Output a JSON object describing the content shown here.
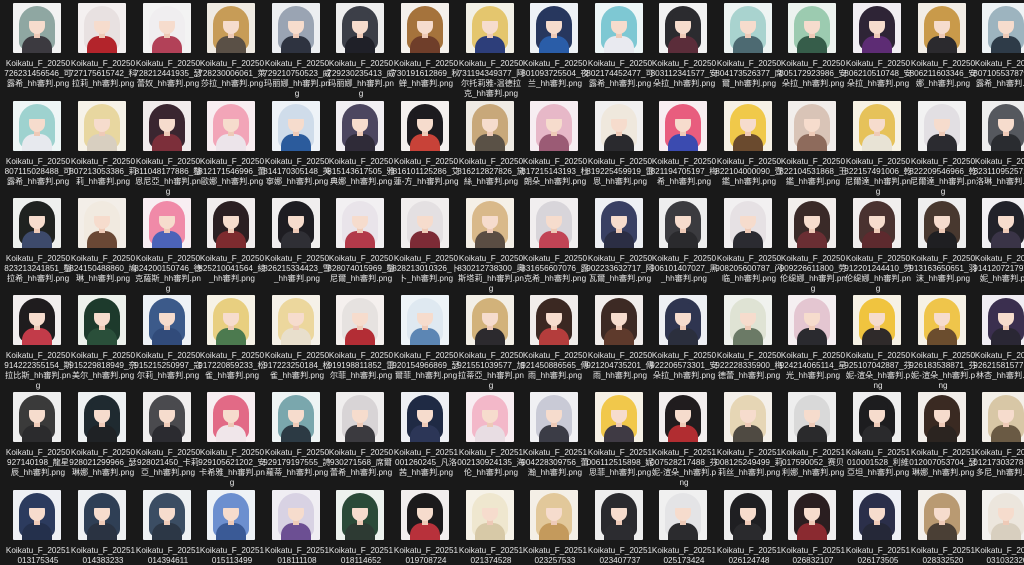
{
  "window": {
    "background": "#191919",
    "text_color": "#e6e6e6"
  },
  "files": [
    {
      "label": "Koikatu_F_20250726231456546_可露希_hh審判.png",
      "thumb_bg": "#f2f2f2",
      "hair": "#8fa7a2",
      "outfit": "#3c3a40"
    },
    {
      "label": "Koikatu_F_20250727175615742_科拉莉_hh審判.png",
      "thumb_bg": "#f4f0f0",
      "hair": "#e8e1e1",
      "outfit": "#b3242b"
    },
    {
      "label": "Koikatu_F_20250728212441935_瑟蕾奴_hh審判.png",
      "thumb_bg": "#f3f3f3",
      "hair": "#f0eef0",
      "outfit": "#b24158"
    },
    {
      "label": "Koikatu_F_20250728230006061_萊莎拉_hh審判.png",
      "thumb_bg": "#efeae2",
      "hair": "#c79c57",
      "outfit": "#5a5046"
    },
    {
      "label": "Koikatu_F_20250729210750523_威玛丽娜_hh審判.png",
      "thumb_bg": "#eceef1",
      "hair": "#9aa4b3",
      "outfit": "#2e3340"
    },
    {
      "label": "Koikatu_F_20250729230235413_威玛丽娜_hh審判.png",
      "thumb_bg": "#eeeeee",
      "hair": "#3c3f48",
      "outfit": "#1f2028"
    },
    {
      "label": "Koikatu_F_20250730191612869_秋蝉_hh審判.png",
      "thumb_bg": "#f5f1ec",
      "hair": "#a5733c",
      "outfit": "#6f3e2a"
    },
    {
      "label": "Koikatu_F_20250731194349377_阿尔托莉雅-温德拉克_hh審判.png",
      "thumb_bg": "#f2f0e6",
      "hair": "#e4c66e",
      "outfit": "#2d3e7a"
    },
    {
      "label": "Koikatu_F_20250801093725504_夜兰_hh審判.png",
      "thumb_bg": "#eef2f6",
      "hair": "#27375e",
      "outfit": "#2a5da8"
    },
    {
      "label": "Koikatu_F_20250802174452477_可露希_hh審判.png",
      "thumb_bg": "#eef6f7",
      "hair": "#7ec8d3",
      "outfit": "#e9eaf0"
    },
    {
      "label": "Koikatu_F_20250803112341577_安朵拉_hh審判.png",
      "thumb_bg": "#f2f2f2",
      "hair": "#2b2b2f",
      "outfit": "#5b2d3a"
    },
    {
      "label": "Koikatu_F_20250804173526377_席爾_hh審判.png",
      "thumb_bg": "#eef4f3",
      "hair": "#a9d3cf",
      "outfit": "#4d6a72"
    },
    {
      "label": "Koikatu_F_20250805172923986_安朵拉_hh審判.png",
      "thumb_bg": "#edf3ef",
      "hair": "#9ccbb0",
      "outfit": "#365d4a"
    },
    {
      "label": "Koikatu_F_20250806210510748_安朵拉_hh審判.png",
      "thumb_bg": "#f1eef3",
      "hair": "#2e2436",
      "outfit": "#5d2c74"
    },
    {
      "label": "Koikatu_F_20250806211603346_安娜_hh審判.png",
      "thumb_bg": "#f2ede6",
      "hair": "#c99a4a",
      "outfit": "#2b2a2e"
    },
    {
      "label": "Koikatu_F_20250807105537879_可露希_hh審判.png",
      "thumb_bg": "#eef3f5",
      "hair": "#9db4bf",
      "outfit": "#2e3b48"
    },
    {
      "label": "Koikatu_F_20250807115028488_可露希_hh審判.png",
      "thumb_bg": "#eef6f6",
      "hair": "#9ed2cf",
      "outfit": "#e7e9ee"
    },
    {
      "label": "Koikatu_F_20250807213053386_莉莉_hh審判.png",
      "thumb_bg": "#f6f2e8",
      "hair": "#e8d7a0",
      "outfit": "#d8cfc0"
    },
    {
      "label": "Koikatu_F_20250811048177886_鑿恩尼亞_hh審判.png",
      "thumb_bg": "#f1ecec",
      "hair": "#3a2630",
      "outfit": "#7c2f3a"
    },
    {
      "label": "Koikatu_F_20250812171546996_蕾歐娜_hh審判.png",
      "thumb_bg": "#f8eef1",
      "hair": "#f2a5b8",
      "outfit": "#ece4ea"
    },
    {
      "label": "Koikatu_F_20250814170305148_芙寧娜_hh審判.png",
      "thumb_bg": "#eef3f8",
      "hair": "#cfdcea",
      "outfit": "#2b5b9c"
    },
    {
      "label": "Koikatu_F_20250815143617505_雅典娜_hh審判.png",
      "thumb_bg": "#f1eff3",
      "hair": "#4c4660",
      "outfit": "#2f2b38"
    },
    {
      "label": "Koikatu_F_20250816101125286_艾蓮-方_hh審判.png",
      "thumb_bg": "#f4f0ee",
      "hair": "#1d1b1f",
      "outfit": "#c84238"
    },
    {
      "label": "Koikatu_F_20250816212827826_黛絲_hh審判.png",
      "thumb_bg": "#efebe4",
      "hair": "#c8a87a",
      "outfit": "#5a5146"
    },
    {
      "label": "Koikatu_F_20250817215143193_杜朗朵_hh審判.png",
      "thumb_bg": "#f7eef2",
      "hair": "#e7b8c8",
      "outfit": "#9b5b75"
    },
    {
      "label": "Koikatu_F_20250819225459919_雷恩_hh審判.png",
      "thumb_bg": "#f1f0f0",
      "hair": "#efe8dd",
      "outfit": "#2a2a2e"
    },
    {
      "label": "Koikatu_F_20250821194705197_梅希_hh審判.png",
      "thumb_bg": "#f8eef1",
      "hair": "#e85d7e",
      "outfit": "#3b4bb0"
    },
    {
      "label": "Koikatu_F_20250822104000090_壹鑑_hh審判.png",
      "thumb_bg": "#f6f1e6",
      "hair": "#f0c94a",
      "outfit": "#6a4a2e"
    },
    {
      "label": "Koikatu_F_20250822104531868_王鑑_hh審判.png",
      "thumb_bg": "#f2eeeb",
      "hair": "#d9c4b7",
      "outfit": "#8e6b5c"
    },
    {
      "label": "Koikatu_F_20250822157491006_乾尼爾達_hh審判.png",
      "thumb_bg": "#f7f2e4",
      "hair": "#e6c25a",
      "outfit": "#e8e3d5"
    },
    {
      "label": "Koikatu_F_20250822209546966_乾尼爾達_hh審判.png",
      "thumb_bg": "#f2f2f2",
      "hair": "#e2dfe3",
      "outfit": "#2b2b30"
    },
    {
      "label": "Koikatu_F_20250823110952571_卡洛琳_hh審判.png",
      "thumb_bg": "#eeeeee",
      "hair": "#55585e",
      "outfit": "#2a2c30"
    },
    {
      "label": "Koikatu_F_20250823213241851_鑿拉希_hh審判.png",
      "thumb_bg": "#eef0ee",
      "hair": "#1f2220",
      "outfit": "#3d4a6b"
    },
    {
      "label": "Koikatu_F_20250824150488860_鳩琳_hh審判.png",
      "thumb_bg": "#f3eee8",
      "hair": "#f1eae0",
      "outfit": "#6a4835"
    },
    {
      "label": "Koikatu_F_20250824200150746_德克薩斯_hh審判.png",
      "thumb_bg": "#f8eef2",
      "hair": "#f08aa8",
      "outfit": "#4c63b8"
    },
    {
      "label": "Koikatu_F_20250825210041564_綾_hh審判.png",
      "thumb_bg": "#f1eded",
      "hair": "#2b1f22",
      "outfit": "#7d2b2f"
    },
    {
      "label": "Koikatu_F_20250826215334423_雪_hh審判.png",
      "thumb_bg": "#f0eeee",
      "hair": "#1e1d22",
      "outfit": "#2f2f35"
    },
    {
      "label": "Koikatu_F_20250828074015969_鑿尼爾_hh審判.png",
      "thumb_bg": "#f2f0f2",
      "hair": "#e9e4ea",
      "outfit": "#b23a4a"
    },
    {
      "label": "Koikatu_F_20250828213010326_卜卜_hh審判.png",
      "thumb_bg": "#f1eeee",
      "hair": "#e4e0e2",
      "outfit": "#7c2b36"
    },
    {
      "label": "Koikatu_F_20250830212738300_奧斯塔莉_hh審判.png",
      "thumb_bg": "#f5f0e7",
      "hair": "#d9b98a",
      "outfit": "#5a4d43"
    },
    {
      "label": "Koikatu_F_20250831656607076_露克希_hh審判.png",
      "thumb_bg": "#f1eeef",
      "hair": "#d8d5da",
      "outfit": "#c14455"
    },
    {
      "label": "Koikatu_F_20250902233632717_阿瓦爾_hh審判.png",
      "thumb_bg": "#eef0f4",
      "hair": "#394063",
      "outfit": "#2b2e44"
    },
    {
      "label": "Koikatu_F_20250906101407027_黑_hh審判.png",
      "thumb_bg": "#eeeeee",
      "hair": "#3b3b3f",
      "outfit": "#2a2a2d"
    },
    {
      "label": "Koikatu_F_20250908205600787_闪临_hh審判.png",
      "thumb_bg": "#f2f0f1",
      "hair": "#e6e1e4",
      "outfit": "#2b2b31"
    },
    {
      "label": "Koikatu_F_20250909226611800_劳伦缇娜_hh審判.png",
      "thumb_bg": "#f2eeec",
      "hair": "#3a2a28",
      "outfit": "#6a2e33"
    },
    {
      "label": "Koikatu_F_20250912201244410_劳伦缇娜_hh審判.png",
      "thumb_bg": "#f1eeee",
      "hair": "#4a3230",
      "outfit": "#5d2a2e"
    },
    {
      "label": "Koikatu_F_20250913163650651_羽沫_hh審判.png",
      "thumb_bg": "#eeeeee",
      "hair": "#48382f",
      "outfit": "#1f1f22"
    },
    {
      "label": "Koikatu_F_20250914120721797_佩妮_hh審判.png",
      "thumb_bg": "#f2f0f3",
      "hair": "#22222a",
      "outfit": "#3a3447"
    },
    {
      "label": "Koikatu_F_20250914222355154_斯拉比斯_hh審判.png",
      "thumb_bg": "#f1eeee",
      "hair": "#1f1c1e",
      "outfit": "#c23b49"
    },
    {
      "label": "Koikatu_F_20250915229818949_奈美尔_hh審判.png",
      "thumb_bg": "#edf1ec",
      "hair": "#1d3a2c",
      "outfit": "#2a4f3a"
    },
    {
      "label": "Koikatu_F_20250915215250997_寇尔莉_hh審判.png",
      "thumb_bg": "#eef2f6",
      "hair": "#3c5a8a",
      "outfit": "#314b7a"
    },
    {
      "label": "Koikatu_F_20250917220859233_松雀_hh審判.png",
      "thumb_bg": "#f6f2e6",
      "hair": "#e8cf80",
      "outfit": "#4c7a4f"
    },
    {
      "label": "Koikatu_F_20250917223250184_松雀_hh審判.png",
      "thumb_bg": "#f5f1e8",
      "hair": "#ecd79d",
      "outfit": "#e8dfcc"
    },
    {
      "label": "Koikatu_F_20250919198811852_雷尔菲_hh審判.png",
      "thumb_bg": "#f5f0ee",
      "hair": "#e6e2e0",
      "outfit": "#b32d35"
    },
    {
      "label": "Koikatu_F_20250920154966869_瑟爾菲_hh審判.png",
      "thumb_bg": "#eef4f8",
      "hair": "#dfe9f1",
      "outfit": "#5c86b4"
    },
    {
      "label": "Koikatu_F_20250921551039577_加拉蒂亞_hh審判.png",
      "thumb_bg": "#f3efe6",
      "hair": "#d2b27a",
      "outfit": "#2c2a2e"
    },
    {
      "label": "Koikatu_F_20250921450886565_傳雨_hh審判.png",
      "thumb_bg": "#f1edeb",
      "hair": "#3b2822",
      "outfit": "#b43d3c"
    },
    {
      "label": "Koikatu_F_20250921204735201_傳雨_hh審判.png",
      "thumb_bg": "#f1edeb",
      "hair": "#3d2a24",
      "outfit": "#5e3a2c"
    },
    {
      "label": "Koikatu_F_20250922206573301_安朵拉_hh審判.png",
      "thumb_bg": "#eef0f4",
      "hair": "#2f3550",
      "outfit": "#2b2f3d"
    },
    {
      "label": "Koikatu_F_20250922228335900_梅德蕾_hh審判.png",
      "thumb_bg": "#f0f2ee",
      "hair": "#dfe3d4",
      "outfit": "#6b7a66"
    },
    {
      "label": "Koikatu_F_20250924214065114_星光_hh審判.png",
      "thumb_bg": "#f5eff1",
      "hair": "#e4c6d1",
      "outfit": "#2a2a2f"
    },
    {
      "label": "Koikatu_F_20250925107042887_芬妮-渲朵_hh審判.png",
      "thumb_bg": "#f6f1e5",
      "hair": "#f0c43f",
      "outfit": "#2f2a2a"
    },
    {
      "label": "Koikatu_F_20250926183538871_芬妮-渲朵_hh審判.png",
      "thumb_bg": "#f6f1e6",
      "hair": "#efc54b",
      "outfit": "#6b4d2e"
    },
    {
      "label": "Koikatu_F_20250926215815771_藤林杏_hh審判.png",
      "thumb_bg": "#f0edf3",
      "hair": "#3b2f4f",
      "outfit": "#2a2734"
    },
    {
      "label": "Koikatu_F_20250927140198_龍星辰_hh審判.png",
      "thumb_bg": "#eeeeee",
      "hair": "#3a3a3a",
      "outfit": "#2b2b2d"
    },
    {
      "label": "Koikatu_F_20250928021299966_瑟琳娜_hh審判.png",
      "thumb_bg": "#eef1f2",
      "hair": "#1f2a30",
      "outfit": "#1f2225"
    },
    {
      "label": "Koikatu_F_20250928021450_卡莉亞_hh審判.png",
      "thumb_bg": "#f0eeee",
      "hair": "#4a4a4e",
      "outfit": "#2b2b30"
    },
    {
      "label": "Koikatu_F_20250929105621202_安卡希雅_hh審判.png",
      "thumb_bg": "#f7eef1",
      "hair": "#e26a86",
      "outfit": "#f0e6ea"
    },
    {
      "label": "Koikatu_F_20250929179197555_詩蘿蒂_hh審判.png",
      "thumb_bg": "#eef4f4",
      "hair": "#7aa7ad",
      "outfit": "#2c3a44"
    },
    {
      "label": "Koikatu_F_20250930271568_席爾蕾希_hh審判.png",
      "thumb_bg": "#f0eeee",
      "hair": "#d8d4d6",
      "outfit": "#3b3a3f"
    },
    {
      "label": "Koikatu_F_20251001260245_凡洛茜_hh審判.png",
      "thumb_bg": "#eef0f4",
      "hair": "#1f2a44",
      "outfit": "#2c3657"
    },
    {
      "label": "Koikatu_F_20251002130924135_海伦_hh審判.png",
      "thumb_bg": "#f8eef2",
      "hair": "#f3b8c9",
      "outfit": "#e8dde3"
    },
    {
      "label": "Koikatu_F_20251004228309756_蕾瀚_hh審判.png",
      "thumb_bg": "#f0f0f3",
      "hair": "#c9cad6",
      "outfit": "#3b3c46"
    },
    {
      "label": "Koikatu_F_20251006112515898_妮思菲_hh審判.png",
      "thumb_bg": "#f6f1e6",
      "hair": "#f1c84b",
      "outfit": "#3f3a44"
    },
    {
      "label": "Koikatu_F_20251007528217488_芬妮-渲朵_hh審判.png",
      "thumb_bg": "#f2eeee",
      "hair": "#201c1e",
      "outfit": "#b12d31"
    },
    {
      "label": "Koikatu_F_20251008125249499_莉莉丝_hh審判.png",
      "thumb_bg": "#f4f0ea",
      "hair": "#e6d6b5",
      "outfit": "#4f4a42"
    },
    {
      "label": "Koikatu_F_20251017590052_赛贝利娜_hh審判.png",
      "thumb_bg": "#eeeeee",
      "hair": "#d9d9d9",
      "outfit": "#2a2a2c"
    },
    {
      "label": "Koikatu_F_20251010001528_利維亞坦_hh審判.png",
      "thumb_bg": "#eeeeee",
      "hair": "#1d1d1f",
      "outfit": "#2a2a2c"
    },
    {
      "label": "Koikatu_F_20251012007053704_瑟琳娜_hh審判.png",
      "thumb_bg": "#f2eeea",
      "hair": "#3a2a22",
      "outfit": "#2b2420"
    },
    {
      "label": "Koikatu_F_20251012173032783_曼多尼_hh審判.png",
      "thumb_bg": "#f3efe8",
      "hair": "#d8c7a6",
      "outfit": "#6a5a44"
    },
    {
      "label": "Koikatu_F_20251013175345",
      "thumb_bg": "#eef0f4",
      "hair": "#2c3b5e",
      "outfit": "#24304c"
    },
    {
      "label": "Koikatu_F_20251014383233",
      "thumb_bg": "#eef0f2",
      "hair": "#2f3f55",
      "outfit": "#2a3342"
    },
    {
      "label": "Koikatu_F_20251014394611",
      "thumb_bg": "#eef1f3",
      "hair": "#3b4d63",
      "outfit": "#2c3746"
    },
    {
      "label": "Koikatu_F_20251015113499",
      "thumb_bg": "#eef2f6",
      "hair": "#6c8fcf",
      "outfit": "#3a5a96"
    },
    {
      "label": "Koikatu_F_20251018111108",
      "thumb_bg": "#f0eef3",
      "hair": "#d8d2e3",
      "outfit": "#6c4f93"
    },
    {
      "label": "Koikatu_F_20251018114652",
      "thumb_bg": "#edf2ee",
      "hair": "#2a4a38",
      "outfit": "#2d3a33"
    },
    {
      "label": "Koikatu_F_20251019708724",
      "thumb_bg": "#f2eeee",
      "hair": "#1c1a1c",
      "outfit": "#b8313b"
    },
    {
      "label": "Koikatu_F_20251021374528",
      "thumb_bg": "#f6f2e8",
      "hair": "#efe7cf",
      "outfit": "#d7c9a7"
    },
    {
      "label": "Koikatu_F_20251023257533",
      "thumb_bg": "#f4efe6",
      "hair": "#e2c89a",
      "outfit": "#c49a5c"
    },
    {
      "label": "Koikatu_F_20251023407737",
      "thumb_bg": "#eeeeee",
      "hair": "#2a2a2e",
      "outfit": "#2c2c30"
    },
    {
      "label": "Koikatu_F_20251025173424",
      "thumb_bg": "#f0f0f0",
      "hair": "#e4e4e6",
      "outfit": "#2b2b2e"
    },
    {
      "label": "Koikatu_F_20251026124748",
      "thumb_bg": "#eeeeee",
      "hair": "#1f1f22",
      "outfit": "#2a2a2d"
    },
    {
      "label": "Koikatu_F_20251026832107",
      "thumb_bg": "#f0eeee",
      "hair": "#2a1e20",
      "outfit": "#8a2a30"
    },
    {
      "label": "Koikatu_F_20251026173505",
      "thumb_bg": "#eef0f6",
      "hair": "#2b2f4a",
      "outfit": "#252838"
    },
    {
      "label": "Koikatu_F_20251028332520",
      "thumb_bg": "#f3efea",
      "hair": "#b99a72",
      "outfit": "#4a3f35"
    },
    {
      "label": "Koikatu_F_20251031032320",
      "thumb_bg": "#f3f1ee",
      "hair": "#ece6dd",
      "outfit": "#d8cfbf"
    }
  ]
}
